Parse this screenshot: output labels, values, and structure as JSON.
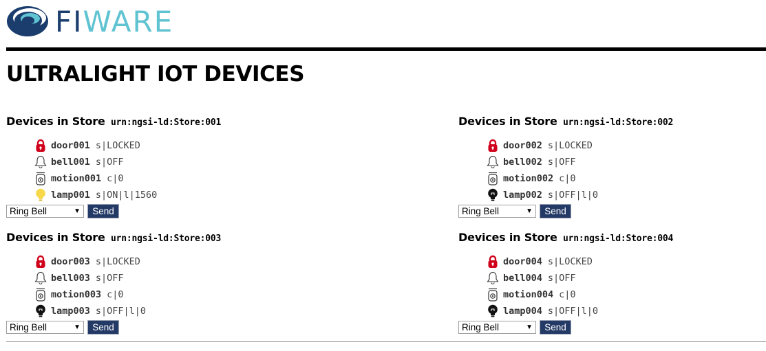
{
  "brand": {
    "fi": "FI",
    "ware": "WARE"
  },
  "page_title": "ULTRALIGHT IOT DEVICES",
  "store_label": "Devices in Store",
  "stores": [
    {
      "urn": "urn:ngsi-ld:Store:001",
      "devices": [
        {
          "name": "door001",
          "state": "s|LOCKED",
          "icon": "lock-icon"
        },
        {
          "name": "bell001",
          "state": "s|OFF",
          "icon": "bell-icon"
        },
        {
          "name": "motion001",
          "state": "c|0",
          "icon": "motion-sensor-icon"
        },
        {
          "name": "lamp001",
          "state": "s|ON|l|1560",
          "icon": "lamp-on-icon"
        }
      ],
      "command": "Ring Bell",
      "send": "Send"
    },
    {
      "urn": "urn:ngsi-ld:Store:002",
      "devices": [
        {
          "name": "door002",
          "state": "s|LOCKED",
          "icon": "lock-icon"
        },
        {
          "name": "bell002",
          "state": "s|OFF",
          "icon": "bell-icon"
        },
        {
          "name": "motion002",
          "state": "c|0",
          "icon": "motion-sensor-icon"
        },
        {
          "name": "lamp002",
          "state": "s|OFF|l|0",
          "icon": "lamp-off-icon"
        }
      ],
      "command": "Ring Bell",
      "send": "Send"
    },
    {
      "urn": "urn:ngsi-ld:Store:003",
      "devices": [
        {
          "name": "door003",
          "state": "s|LOCKED",
          "icon": "lock-icon"
        },
        {
          "name": "bell003",
          "state": "s|OFF",
          "icon": "bell-icon"
        },
        {
          "name": "motion003",
          "state": "c|0",
          "icon": "motion-sensor-icon"
        },
        {
          "name": "lamp003",
          "state": "s|OFF|l|0",
          "icon": "lamp-off-icon"
        }
      ],
      "command": "Ring Bell",
      "send": "Send"
    },
    {
      "urn": "urn:ngsi-ld:Store:004",
      "devices": [
        {
          "name": "door004",
          "state": "s|LOCKED",
          "icon": "lock-icon"
        },
        {
          "name": "bell004",
          "state": "s|OFF",
          "icon": "bell-icon"
        },
        {
          "name": "motion004",
          "state": "c|0",
          "icon": "motion-sensor-icon"
        },
        {
          "name": "lamp004",
          "state": "s|OFF|l|0",
          "icon": "lamp-off-icon"
        }
      ],
      "command": "Ring Bell",
      "send": "Send"
    }
  ],
  "colors": {
    "lock": "#d0021b",
    "lamp_on": "#f7d84a",
    "button": "#243a66"
  }
}
